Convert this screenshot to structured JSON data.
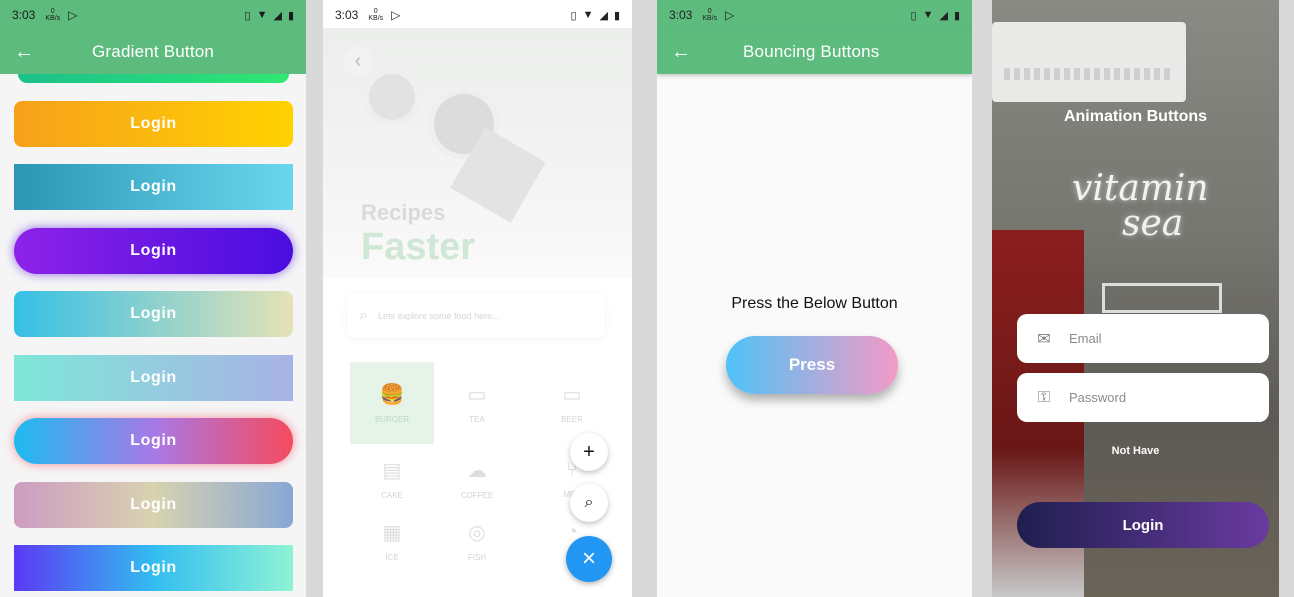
{
  "phone1": {
    "status": {
      "time": "3:03",
      "kb_top": "0",
      "kb_bottom": "KB/s"
    },
    "title": "Gradient Button",
    "buttons": [
      {
        "label": "Login",
        "gradient": [
          "#f7a01c",
          "#ffd200"
        ],
        "shape": "rounded"
      },
      {
        "label": "Login",
        "gradient": [
          "#2c96b4",
          "#6ad7ee"
        ],
        "shape": "square"
      },
      {
        "label": "Login",
        "gradient": [
          "#8e22e8",
          "#4a0de0"
        ],
        "shape": "pill"
      },
      {
        "label": "Login",
        "gradient": [
          "#35c0e6",
          "#e4e2b6"
        ],
        "shape": "rounded"
      },
      {
        "label": "Login",
        "gradient": [
          "#7ee7d8",
          "#a9b2e6"
        ],
        "shape": "square"
      },
      {
        "label": "Login",
        "gradient": [
          "#1dbbef",
          "#a779e6",
          "#f54b5e"
        ],
        "shape": "pill"
      },
      {
        "label": "Login",
        "gradient": [
          "#cd9bc2",
          "#d8d3b0",
          "#87a7d3"
        ],
        "shape": "rounded"
      },
      {
        "label": "Login",
        "gradient": [
          "#5b39f4",
          "#33bdf0",
          "#8ef3d6"
        ],
        "shape": "square"
      }
    ]
  },
  "phone2": {
    "status": {
      "time": "3:03",
      "kb_top": "0",
      "kb_bottom": "KB/s"
    },
    "heading_small": "Recipes",
    "heading_large": "Faster",
    "search_placeholder": "Lets explore some food here...",
    "categories": [
      {
        "label": "BURGER",
        "icon": "burger-icon",
        "selected": true
      },
      {
        "label": "TEA",
        "icon": "cup-icon"
      },
      {
        "label": "BEER",
        "icon": "beer-icon"
      },
      {
        "label": "CAKE",
        "icon": "cake-icon"
      },
      {
        "label": "COFFEE",
        "icon": "cloud-icon"
      },
      {
        "label": "MEA",
        "icon": "utensils-icon"
      },
      {
        "label": "ICE",
        "icon": "chart-icon"
      },
      {
        "label": "FISH",
        "icon": "target-icon"
      },
      {
        "label": "DO",
        "icon": "pie-icon"
      }
    ],
    "fab_add": "+",
    "fab_search": "search-icon",
    "fab_close": "×"
  },
  "phone3": {
    "status": {
      "time": "3:03",
      "kb_top": "0",
      "kb_bottom": "KB/s"
    },
    "title": "Bouncing Buttons",
    "prompt": "Press the Below Button",
    "button_label": "Press",
    "gradient": [
      "#4fc3f7",
      "#f39ac7"
    ]
  },
  "phone4": {
    "title": "Animation Buttons",
    "neon_line1": "vitamin",
    "neon_line2": "sea",
    "email_placeholder": "Email",
    "password_placeholder": "Password",
    "not_have": "Not Have",
    "login_label": "Login",
    "gradient": [
      "#1f1f4f",
      "#6a3aa0"
    ]
  }
}
